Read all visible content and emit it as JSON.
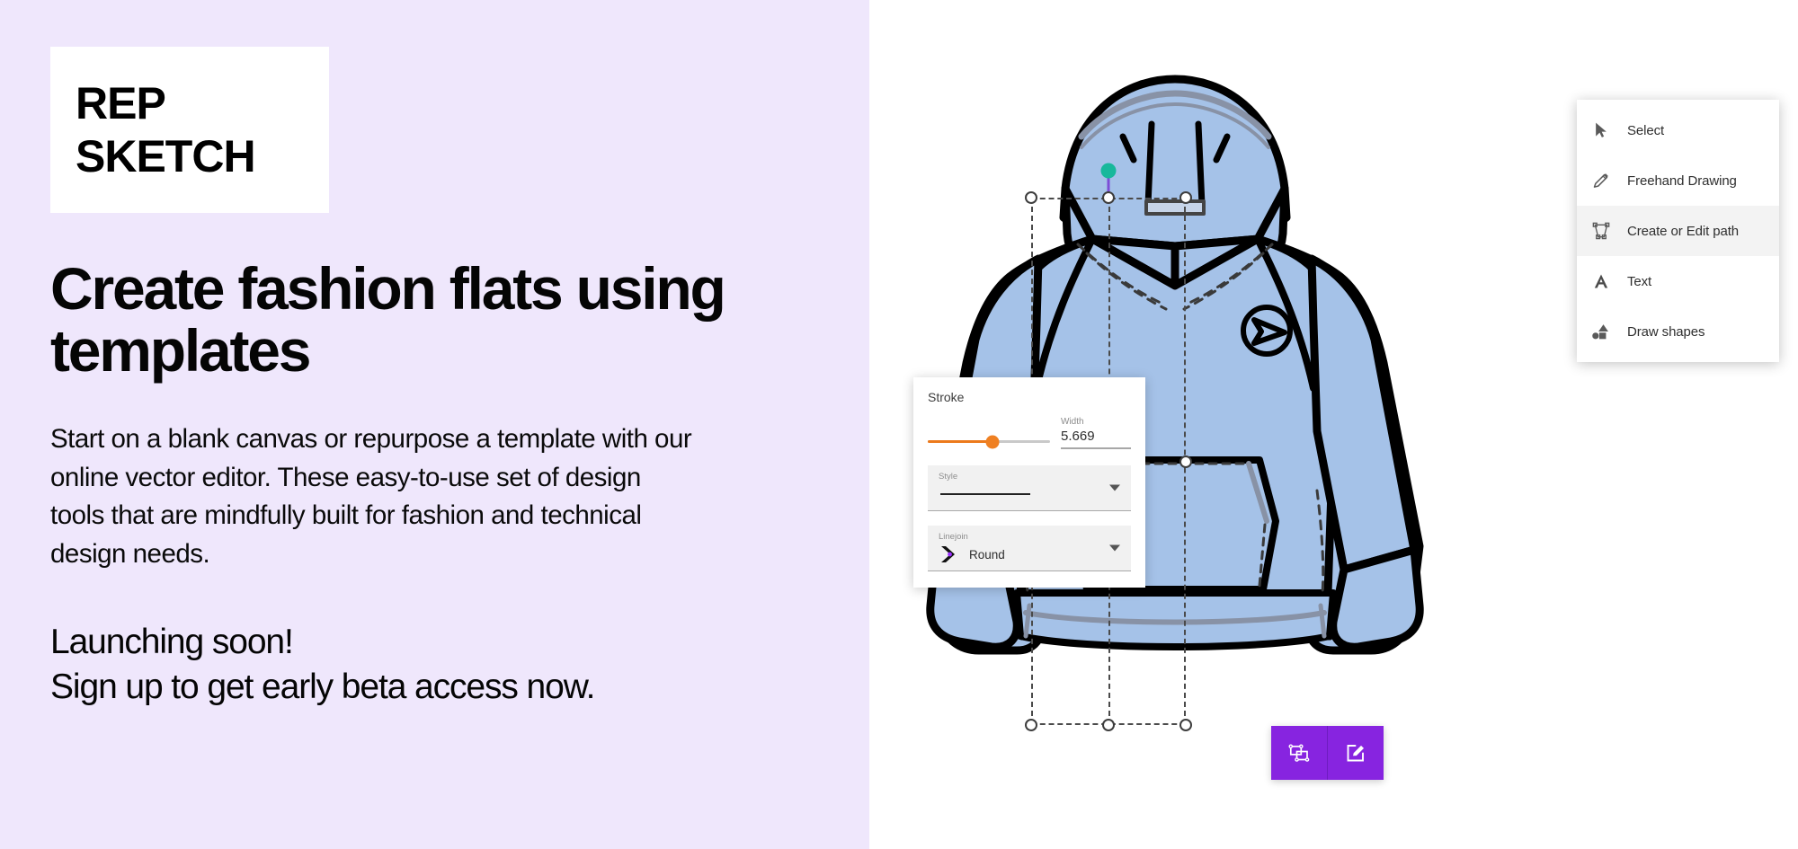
{
  "brand": {
    "logo_line_1": "REP",
    "logo_line_2": "SKETCH"
  },
  "hero": {
    "headline": "Create fashion flats using templates",
    "body": "Start on a blank canvas or repurpose a template with our online vector editor. These easy-to-use set of design tools that are mindfully built for fashion and technical design needs.",
    "cta_line_1": "Launching soon!",
    "cta_line_2": "Sign up to get early beta access now."
  },
  "colors": {
    "panel_background": "#EFE7FC",
    "canvas_background": "#FFFFFF",
    "garment_fill": "#A5C2E8",
    "garment_outline": "#000000",
    "garment_stitch": "#8892A6",
    "accent_purple": "#8724E0",
    "slider_orange": "#EF8022",
    "rotate_handle_teal": "#17B89B",
    "rotate_stem_purple": "#7C4DD6"
  },
  "stroke_panel": {
    "title": "Stroke",
    "width_label": "Width",
    "width_value": "5.669",
    "slider_percent": 53,
    "style": {
      "label": "Style",
      "value": ""
    },
    "linejoin": {
      "label": "Linejoin",
      "value": "Round"
    }
  },
  "tool_menu": {
    "items": [
      {
        "label": "Select",
        "icon": "cursor-arrow-icon",
        "active": false
      },
      {
        "label": "Freehand Drawing",
        "icon": "pencil-icon",
        "active": false
      },
      {
        "label": "Create or Edit path",
        "icon": "node-path-icon",
        "active": true
      },
      {
        "label": "Text",
        "icon": "text-a-icon",
        "active": false
      },
      {
        "label": "Draw shapes",
        "icon": "shapes-icon",
        "active": false
      }
    ]
  },
  "action_bar": {
    "buttons": [
      {
        "name": "edit-nodes-button",
        "icon": "node-transform-icon"
      },
      {
        "name": "edit-object-button",
        "icon": "edit-square-pencil-icon"
      }
    ]
  },
  "canvas": {
    "garment": "hooded-sweatshirt-technical-flat",
    "badge_logo": "circle-arrow-badge-icon",
    "selection": {
      "handles": 8,
      "rotate_handle": true,
      "style": "dashed-bounding-box"
    }
  }
}
